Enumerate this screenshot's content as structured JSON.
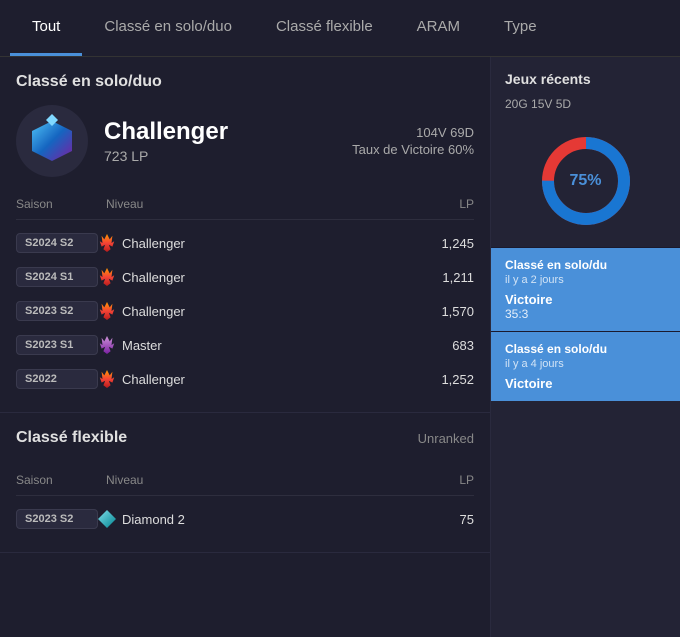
{
  "tabs": [
    {
      "label": "Tout",
      "active": true
    },
    {
      "label": "Classé en solo/duo",
      "active": false
    },
    {
      "label": "Classé flexible",
      "active": false
    },
    {
      "label": "ARAM",
      "active": false
    },
    {
      "label": "Type",
      "active": false
    }
  ],
  "solo_section": {
    "title": "Classé en solo/duo",
    "rank": "Challenger",
    "lp": "723 LP",
    "wins": "104V",
    "losses": "69D",
    "winrate": "Taux de Victoire 60%",
    "table_headers": {
      "saison": "Saison",
      "niveau": "Niveau",
      "lp": "LP"
    },
    "seasons": [
      {
        "badge": "S2024 S2",
        "tier": "Challenger",
        "tier_type": "challenger",
        "lp": "1,245"
      },
      {
        "badge": "S2024 S1",
        "tier": "Challenger",
        "tier_type": "challenger",
        "lp": "1,211"
      },
      {
        "badge": "S2023 S2",
        "tier": "Challenger",
        "tier_type": "challenger",
        "lp": "1,570"
      },
      {
        "badge": "S2023 S1",
        "tier": "Master",
        "tier_type": "master",
        "lp": "683"
      },
      {
        "badge": "S2022",
        "tier": "Challenger",
        "tier_type": "challenger",
        "lp": "1,252"
      }
    ]
  },
  "flex_section": {
    "title": "Classé flexible",
    "unranked": "Unranked",
    "table_headers": {
      "saison": "Saison",
      "niveau": "Niveau",
      "lp": "LP"
    },
    "seasons": [
      {
        "badge": "S2023 S2",
        "tier": "Diamond 2",
        "tier_type": "diamond",
        "lp": "75"
      }
    ]
  },
  "recent_games": {
    "title": "Jeux récents",
    "stats": "20G 15V 5D",
    "winrate_pct": "75%",
    "winrate_value": 75,
    "cards": [
      {
        "type": "Classé en solo/du",
        "time": "il y a 2 jours",
        "result": "Victoire",
        "score": "35:3"
      },
      {
        "type": "Classé en solo/du",
        "time": "il y a 4 jours",
        "result": "Victoire",
        "score": ""
      }
    ]
  }
}
